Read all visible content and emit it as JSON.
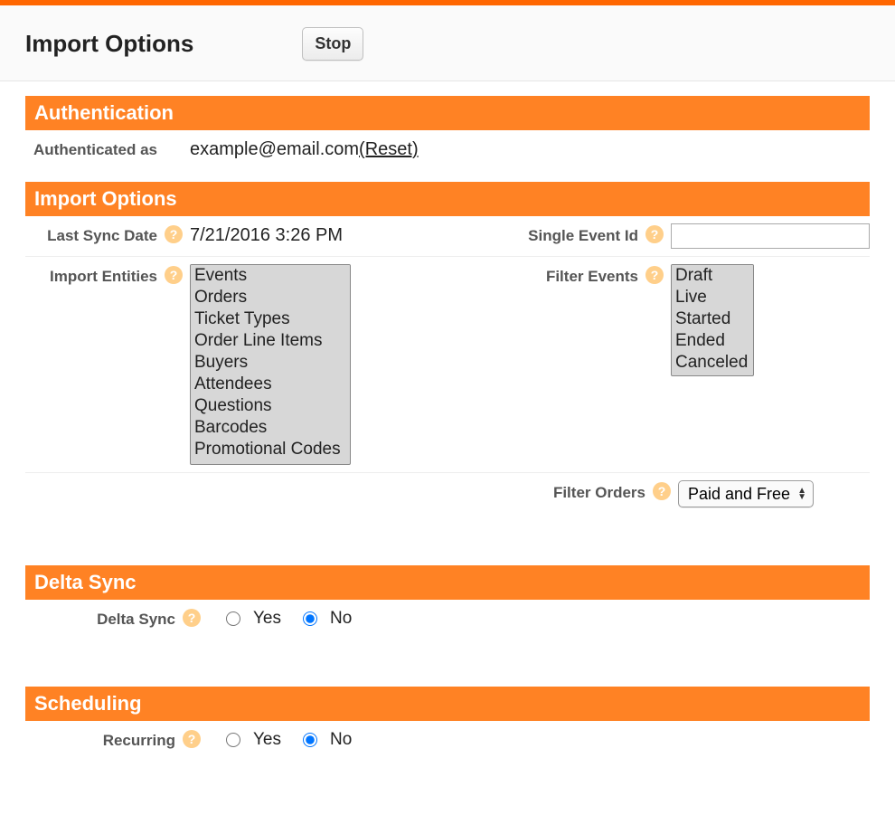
{
  "header": {
    "title": "Import Options",
    "stopLabel": "Stop"
  },
  "sections": {
    "auth": {
      "title": "Authentication",
      "authAsLabel": "Authenticated as",
      "authEmail": "example@email.com",
      "resetLabel": "(Reset)"
    },
    "importOptions": {
      "title": "Import Options",
      "lastSyncLabel": "Last Sync Date",
      "lastSyncValue": "7/21/2016 3:26 PM",
      "singleEventIdLabel": "Single Event Id",
      "singleEventIdValue": "",
      "importEntitiesLabel": "Import Entities",
      "importEntities": [
        "Events",
        "Orders",
        "Ticket Types",
        "Order Line Items",
        "Buyers",
        "Attendees",
        "Questions",
        "Barcodes",
        "Promotional Codes"
      ],
      "filterEventsLabel": "Filter Events",
      "filterEvents": [
        "Draft",
        "Live",
        "Started",
        "Ended",
        "Canceled"
      ],
      "filterOrdersLabel": "Filter Orders",
      "filterOrdersSelected": "Paid and Free",
      "filterOrdersOptions": [
        "Paid and Free"
      ]
    },
    "deltaSync": {
      "title": "Delta Sync",
      "label": "Delta Sync",
      "yes": "Yes",
      "no": "No",
      "value": "No"
    },
    "scheduling": {
      "title": "Scheduling",
      "label": "Recurring",
      "yes": "Yes",
      "no": "No",
      "value": "No"
    }
  },
  "helpGlyph": "?"
}
